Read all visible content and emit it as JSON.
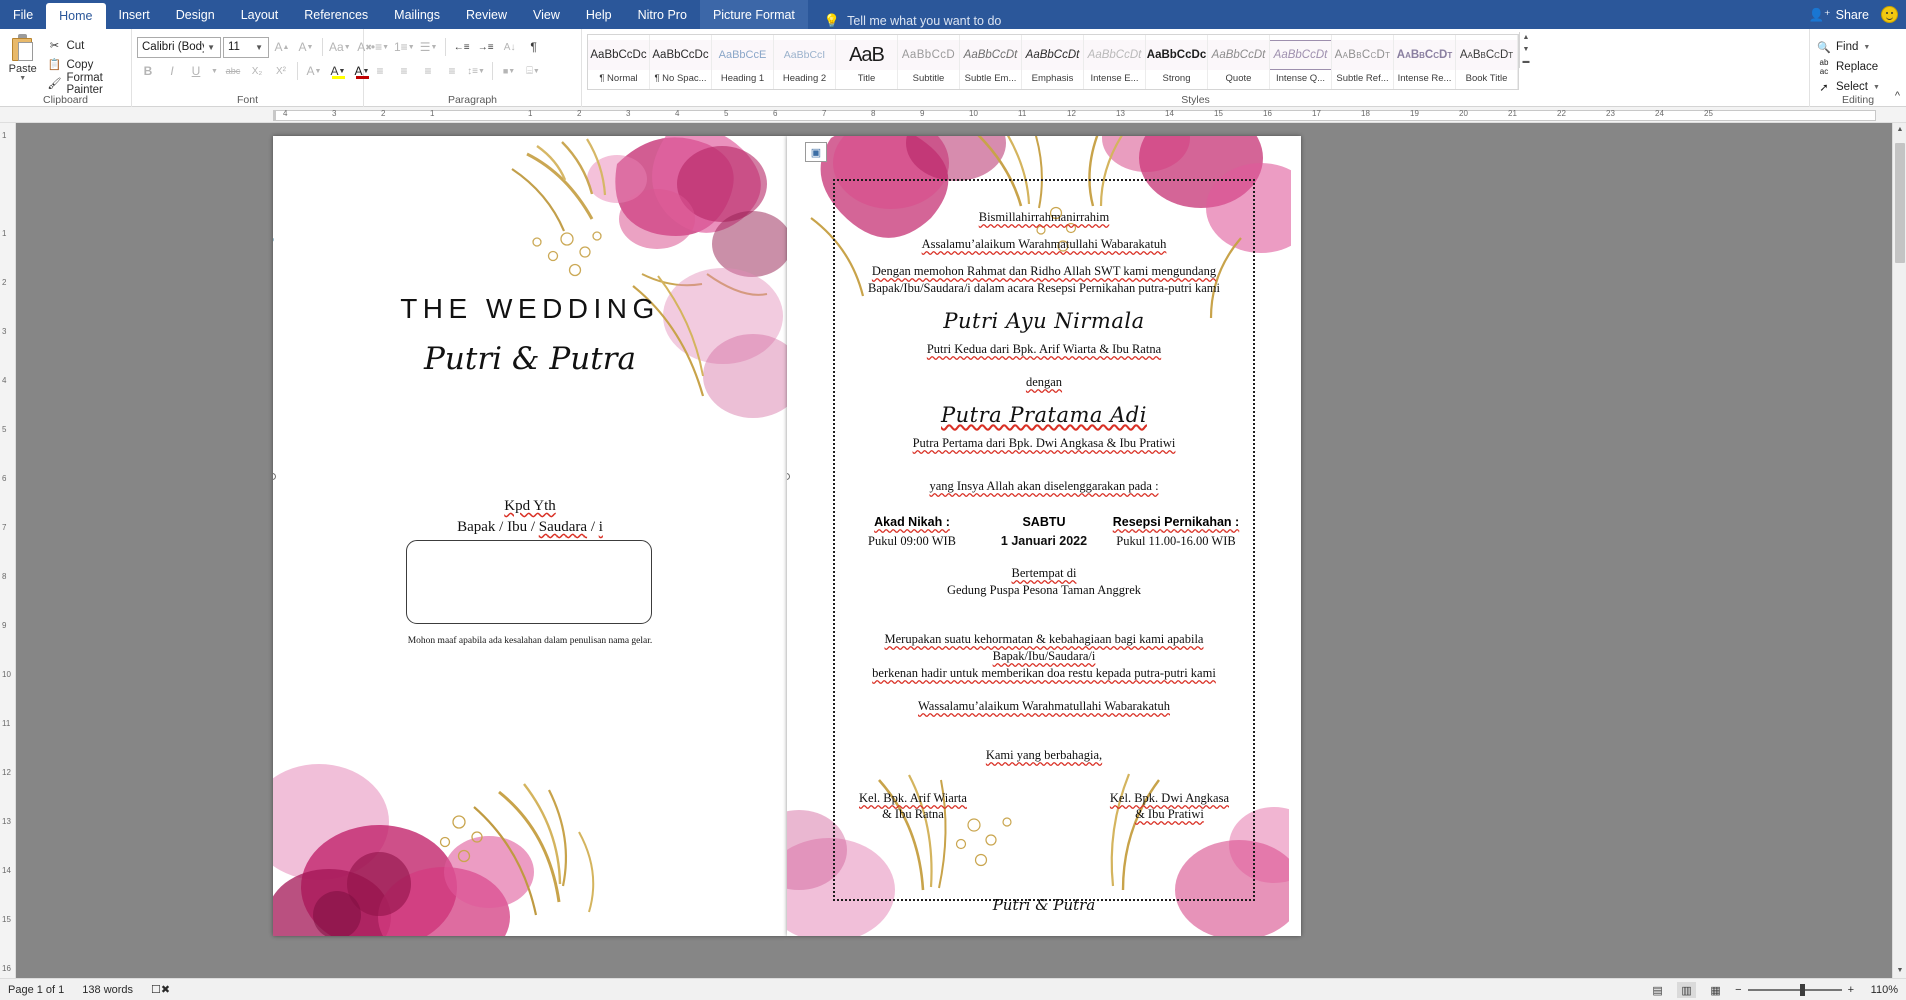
{
  "app": {
    "tabs": [
      {
        "label": "File",
        "state": "file"
      },
      {
        "label": "Home",
        "state": "active"
      },
      {
        "label": "Insert",
        "state": "normal"
      },
      {
        "label": "Design",
        "state": "normal"
      },
      {
        "label": "Layout",
        "state": "normal"
      },
      {
        "label": "References",
        "state": "normal"
      },
      {
        "label": "Mailings",
        "state": "normal"
      },
      {
        "label": "Review",
        "state": "normal"
      },
      {
        "label": "View",
        "state": "normal"
      },
      {
        "label": "Help",
        "state": "normal"
      },
      {
        "label": "Nitro Pro",
        "state": "normal"
      },
      {
        "label": "Picture Format",
        "state": "contextual"
      }
    ],
    "tell_me": "Tell me what you want to do",
    "share": "Share",
    "title_accent": "#2b579a"
  },
  "ribbon": {
    "clipboard": {
      "group_label": "Clipboard",
      "paste": "Paste",
      "cut": "Cut",
      "copy": "Copy",
      "format_painter": "Format Painter"
    },
    "font": {
      "group_label": "Font",
      "font_name": "Calibri (Body",
      "font_size": "11",
      "grow_font": "A",
      "shrink_font": "A",
      "change_case": "Aa",
      "clear_formatting": "A",
      "bold": "B",
      "italic": "I",
      "underline": "U",
      "strikethrough": "abc",
      "subscript": "X₂",
      "superscript": "X²",
      "text_effects": "A",
      "highlight": "A",
      "font_color": "A",
      "font_color_hex": "#c00000"
    },
    "paragraph": {
      "group_label": "Paragraph",
      "bullets": "•≡",
      "numbering": "1≡",
      "multilevel": "☰",
      "decrease_indent": "←≡",
      "increase_indent": "→≡",
      "sort": "A↓",
      "show_marks": "¶",
      "align_left": "≡",
      "align_center": "≡",
      "align_right": "≡",
      "justify": "≡",
      "line_spacing": "↕≡",
      "shading": "■",
      "borders": "⌸"
    },
    "styles": {
      "group_label": "Styles",
      "items": [
        {
          "preview": "AaBbCcDc",
          "name": "¶ Normal",
          "cls": "s-normal"
        },
        {
          "preview": "AaBbCcDc",
          "name": "¶ No Spac...",
          "cls": "s-normal"
        },
        {
          "preview": "AaBbCcE",
          "name": "Heading 1",
          "cls": "s-h1"
        },
        {
          "preview": "AaBbCcI",
          "name": "Heading 2",
          "cls": "s-h2"
        },
        {
          "preview": "AaB",
          "name": "Title",
          "cls": "s-title"
        },
        {
          "preview": "AaBbCcD",
          "name": "Subtitle",
          "cls": "s-sub"
        },
        {
          "preview": "AaBbCcDt",
          "name": "Subtle Em...",
          "cls": "s-em"
        },
        {
          "preview": "AaBbCcDt",
          "name": "Emphasis",
          "cls": "s-em2"
        },
        {
          "preview": "AaBbCcDt",
          "name": "Intense E...",
          "cls": "s-ie"
        },
        {
          "preview": "AaBbCcDc",
          "name": "Strong",
          "cls": "s-strong"
        },
        {
          "preview": "AaBbCcDt",
          "name": "Quote",
          "cls": "s-quote"
        },
        {
          "preview": "AaBbCcDt",
          "name": "Intense Q...",
          "cls": "s-iq"
        },
        {
          "preview": "AaBbCcDt",
          "name": "Subtle Ref...",
          "cls": "s-sref"
        },
        {
          "preview": "AaBbCcDt",
          "name": "Intense Re...",
          "cls": "s-iref"
        },
        {
          "preview": "AaBbCcDt",
          "name": "Book Title",
          "cls": "s-book"
        }
      ]
    },
    "editing": {
      "group_label": "Editing",
      "find": "Find",
      "replace": "Replace",
      "select": "Select"
    }
  },
  "ruler": {
    "h_ticks": [
      "4",
      "3",
      "2",
      "1",
      "",
      "1",
      "2",
      "3",
      "4",
      "5",
      "6",
      "7",
      "8",
      "9",
      "10",
      "11",
      "12",
      "13",
      "14",
      "15",
      "16",
      "17",
      "18",
      "19",
      "20",
      "21",
      "22",
      "23",
      "24",
      "25"
    ],
    "v_ticks": [
      "1",
      "",
      "1",
      "2",
      "3",
      "4",
      "5",
      "6",
      "7",
      "8",
      "9",
      "10",
      "11",
      "12",
      "13",
      "14",
      "15",
      "16"
    ]
  },
  "document": {
    "left_page": {
      "title": "THE WEDDING",
      "couple_script": "Putri & Putra",
      "kpd_line1": "Kpd Yth",
      "kpd_line2_a": "Bapak / Ibu / ",
      "kpd_line2_b": "Saudara",
      "kpd_line2_c": " / ",
      "kpd_line2_d": "i",
      "note": "Mohon maaf apabila ada kesalahan dalam penulisan nama gelar."
    },
    "right_page": {
      "bismillah": "Bismillahirrahmanirrahim",
      "salam": "Assalamu’alaikum Warahmatullahi Wabarakatuh",
      "intro_line1": "Dengan memohon Rahmat dan Ridho Allah SWT kami mengundang",
      "intro_line2": "Bapak/Ibu/Saudara/i dalam acara Resepsi Pernikahan putra-putri kami",
      "bride_name": "Putri Ayu Nirmala",
      "bride_parents": "Putri Kedua dari Bpk. Arif Wiarta & Ibu Ratna",
      "dengan": "dengan",
      "groom_name": "Putra Pratama Adi",
      "groom_parents": "Putra Pertama dari Bpk. Dwi Angkasa & Ibu Pratiwi",
      "schedule_intro": "yang Insya Allah akan diselenggarakan pada :",
      "events": [
        {
          "head": "Akad Nikah :",
          "sub": "Pukul 09:00 WIB",
          "style": "serif"
        },
        {
          "head": "SABTU",
          "sub": "1 Januari 2022",
          "style": "sans"
        },
        {
          "head": "Resepsi Pernikahan :",
          "sub": "Pukul 11.00-16.00 WIB",
          "style": "serif"
        }
      ],
      "venue_label": "Bertempat di",
      "venue_name": "Gedung Puspa Pesona Taman Anggrek",
      "closing_line1": "Merupakan suatu kehormatan & kebahagiaan bagi kami apabila Bapak/Ibu/Saudara/i",
      "closing_line2": "berkenan hadir untuk memberikan doa restu kepada putra-putri kami",
      "wassalam": "Wassalamu’alaikum Warahmatullahi Wabarakatuh",
      "kami": "Kami yang berbahagia,",
      "family_left_l1": "Kel. Bpk. Arif Wiarta",
      "family_left_l2": "& Ibu Ratna",
      "family_right_l1": "Kel. Bpk. Dwi Angkasa",
      "family_right_l2": "& Ibu Pratiwi",
      "signature": "Putri & Putra"
    }
  },
  "status": {
    "page": "Page 1 of 1",
    "words": "138 words",
    "proofing_icon": "proofing-errors-icon",
    "views": [
      {
        "name": "read-mode",
        "glyph": "▤",
        "active": false
      },
      {
        "name": "print-layout",
        "glyph": "▥",
        "active": true
      },
      {
        "name": "web-layout",
        "glyph": "▦",
        "active": false
      }
    ],
    "zoom_out": "−",
    "zoom_in": "+",
    "zoom_value": "110%"
  }
}
